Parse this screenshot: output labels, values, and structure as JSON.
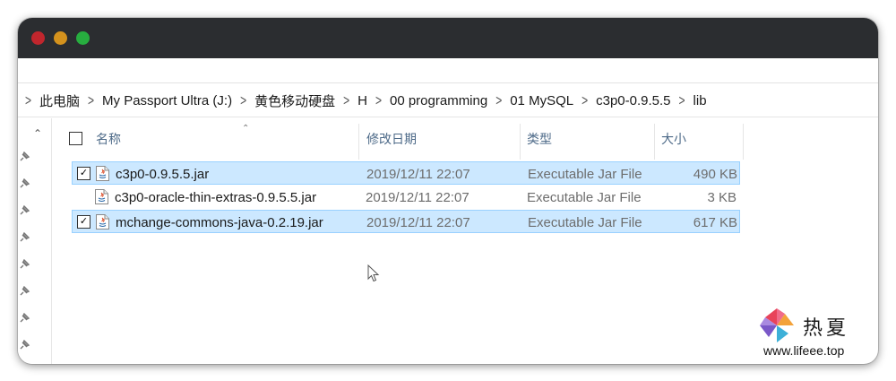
{
  "window": {
    "traffic_lights": [
      "close",
      "minimize",
      "maximize"
    ],
    "colors": {
      "red": "#c0262d",
      "yellow": "#d4921d",
      "green": "#27ad3f",
      "titlebar": "#2b2d30"
    }
  },
  "breadcrumb": {
    "items": [
      "此电脑",
      "My Passport Ultra (J:)",
      "黄色移动硬盘",
      "H",
      "00 programming",
      "01 MySQL",
      "c3p0-0.9.5.5",
      "lib"
    ]
  },
  "columns": {
    "name": "名称",
    "modified": "修改日期",
    "type": "类型",
    "size": "大小"
  },
  "files": [
    {
      "name": "c3p0-0.9.5.5.jar",
      "modified": "2019/12/11 22:07",
      "type": "Executable Jar File",
      "size": "490 KB",
      "selected": true,
      "checked": true
    },
    {
      "name": "c3p0-oracle-thin-extras-0.9.5.5.jar",
      "modified": "2019/12/11 22:07",
      "type": "Executable Jar File",
      "size": "3 KB",
      "selected": false,
      "checked": false
    },
    {
      "name": "mchange-commons-java-0.2.19.jar",
      "modified": "2019/12/11 22:07",
      "type": "Executable Jar File",
      "size": "617 KB",
      "selected": true,
      "checked": true
    }
  ],
  "watermark": {
    "text": "热夏",
    "url": "www.lifeee.top"
  },
  "selection_color": "#cce8ff"
}
